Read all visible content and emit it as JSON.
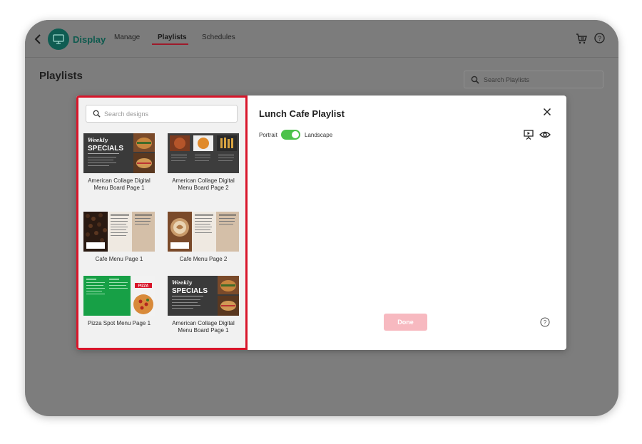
{
  "header": {
    "logo_text": "Display",
    "nav": [
      {
        "label": "Manage"
      },
      {
        "label": "Playlists"
      },
      {
        "label": "Schedules"
      }
    ]
  },
  "page": {
    "title": "Playlists",
    "search_placeholder": "Search Playlists"
  },
  "modal": {
    "design_search_placeholder": "Search designs",
    "designs": [
      {
        "label": "American Collage Digital Menu Board Page 1"
      },
      {
        "label": "American Collage Digital Menu Board Page 2"
      },
      {
        "label": "Cafe Menu Page 1"
      },
      {
        "label": "Cafe Menu Page 2"
      },
      {
        "label": "Pizza Spot Menu Page 1"
      },
      {
        "label": "American Collage Digital Menu Board Page 1"
      }
    ],
    "thumb_text": {
      "weekly": "Weekly",
      "specials": "SPECIALS",
      "pizza": "PIZZA"
    },
    "playlist_title": "Lunch Cafe Playlist",
    "orientation": {
      "portrait": "Portrait",
      "landscape": "Landscape",
      "landscape_on": true
    },
    "done_label": "Done"
  },
  "colors": {
    "accent_red": "#d8152a",
    "brand_green": "#0f5c52",
    "toggle_green": "#4cc24a",
    "done_disabled": "#f7b9c0"
  }
}
